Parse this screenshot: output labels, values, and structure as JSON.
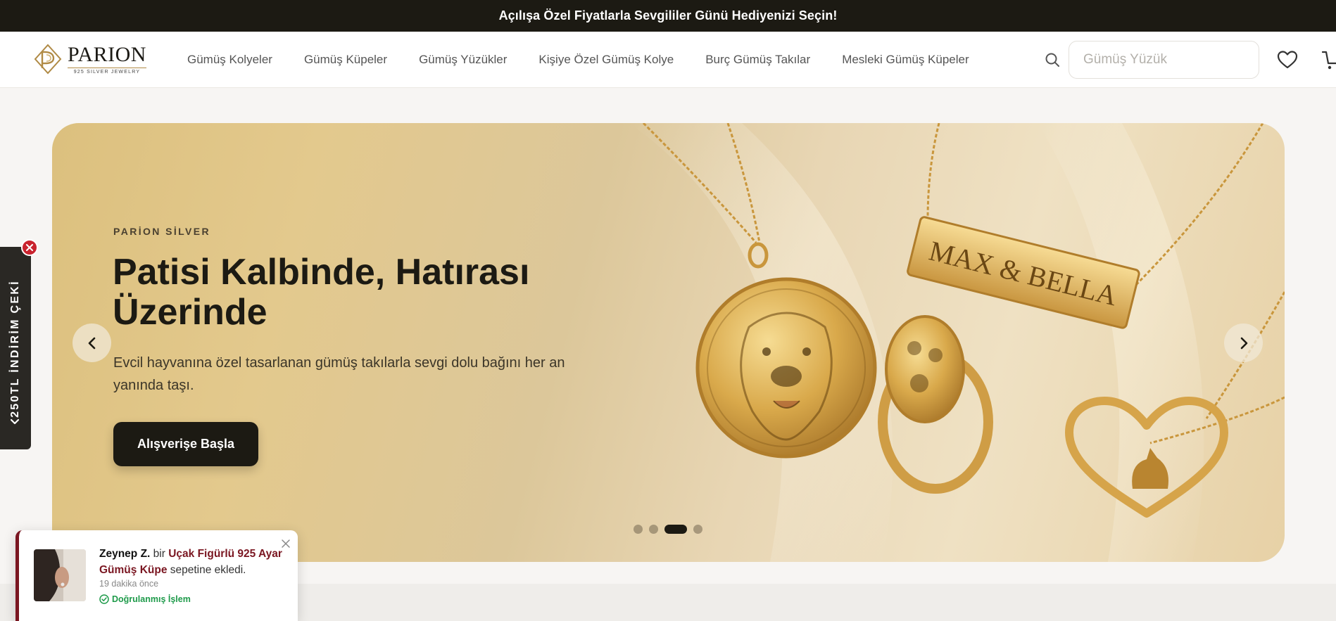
{
  "announcement": "Açılışa Özel Fiyatlarla Sevgililer Günü Hediyenizi Seçin!",
  "brand": {
    "name": "PARION",
    "tagline": "925 SILVER JEWELRY",
    "accent": "#b08a45"
  },
  "nav": {
    "items": [
      "Gümüş Kolyeler",
      "Gümüş Küpeler",
      "Gümüş Yüzükler",
      "Kişiye Özel Gümüş Kolye",
      "Burç Gümüş Takılar",
      "Mesleki Gümüş Küpeler"
    ]
  },
  "search": {
    "placeholder": "Gümüş Yüzük",
    "value": ""
  },
  "icons": [
    "search-icon",
    "heart-icon",
    "cart-icon"
  ],
  "hero": {
    "eyebrow": "PARİON SİLVER",
    "title": "Patisi Kalbinde, Hatırası Üzerinde",
    "description": "Evcil hayvanına özel tasarlanan gümüş takılarla sevgi dolu bağını her an yanında taşı.",
    "cta": "Alışverişe Başla",
    "engraving": "MAX & BELLA",
    "slides": {
      "count": 4,
      "active": 3
    }
  },
  "side_tab": {
    "label": "250TL İNDİRİM ÇEKİ"
  },
  "toast": {
    "name": "Zeynep Z.",
    "connector": "bir",
    "product": "Uçak Figürlü 925 Ayar Gümüş Küpe",
    "action": "sepetine ekledi.",
    "time": "19 dakika önce",
    "verified": "Doğrulanmış İşlem"
  },
  "colors": {
    "dark": "#1c1a13",
    "toast_accent": "#7a1621",
    "verified": "#1f9b4b",
    "close_badge": "#c9232e"
  }
}
